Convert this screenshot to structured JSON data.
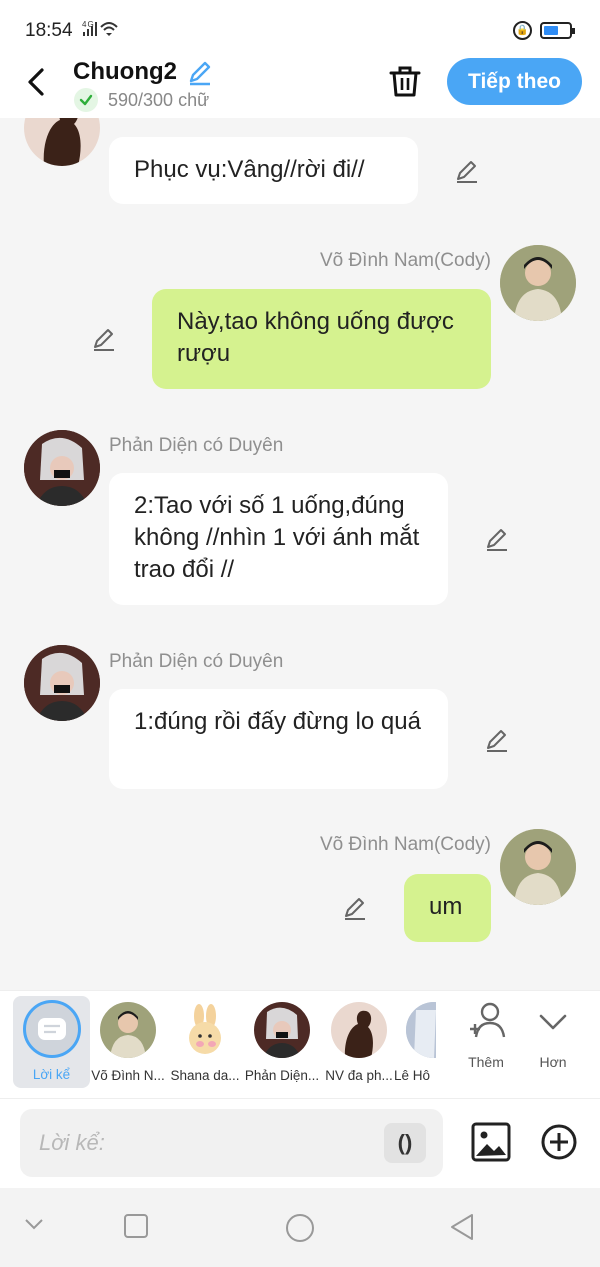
{
  "status_bar": {
    "time": "18:54",
    "network": "4G"
  },
  "header": {
    "title": "Chuong2",
    "word_count": "590/300 chữ",
    "next_label": "Tiếp theo"
  },
  "messages": [
    {
      "side": "left",
      "name": "",
      "text": "Phục vụ:Vâng//rời đi//"
    },
    {
      "side": "right",
      "name": "Võ Đình Nam(Cody)",
      "text": "Này,tao không uống được rượu"
    },
    {
      "side": "left",
      "name": "Phản Diện có Duyên",
      "text": "2:Tao với số 1 uống,đúng không //nhìn 1 với ánh mắt trao đổi //"
    },
    {
      "side": "left",
      "name": "Phản Diện có Duyên",
      "text": "1:đúng rồi đấy đừng lo quá"
    },
    {
      "side": "right",
      "name": "Võ Đình Nam(Cody)",
      "text": "um"
    }
  ],
  "characters": [
    {
      "label": "Lời kể",
      "selected": true
    },
    {
      "label": "Võ Đình N..."
    },
    {
      "label": "Shana da..."
    },
    {
      "label": "Phản Diện..."
    },
    {
      "label": "NV đa ph..."
    },
    {
      "label": "Lê Hô"
    }
  ],
  "extra_actions": {
    "add_label": "Thêm",
    "more_label": "Hơn"
  },
  "input": {
    "placeholder": "Lời kể:",
    "paren_button": "()"
  },
  "colors": {
    "accent": "#4aa6f5",
    "right_bubble": "#d5f28f",
    "check_green": "#2fae3b"
  }
}
